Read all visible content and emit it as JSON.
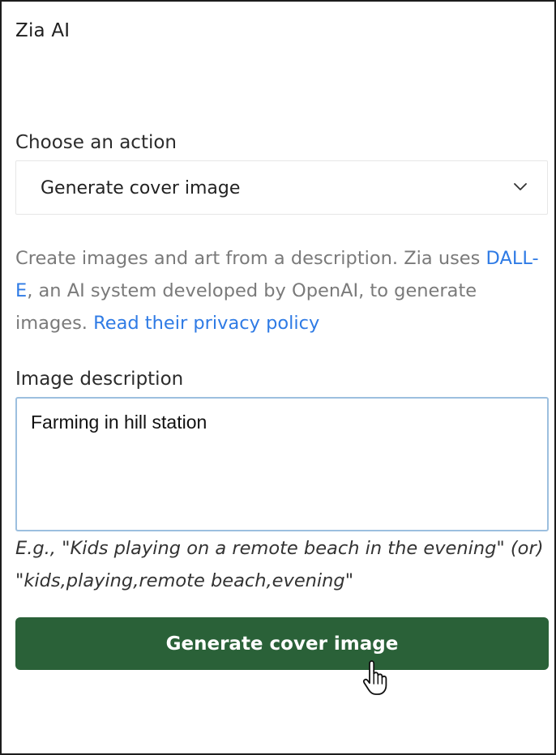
{
  "panel": {
    "title": "Zia AI"
  },
  "action": {
    "label": "Choose an action",
    "selected": "Generate cover image"
  },
  "help": {
    "text_before": "Create images and art from a description. Zia uses ",
    "dalle_link": "DALL-E",
    "text_middle": ", an AI system developed by OpenAI, to generate images. ",
    "privacy_link": "Read their privacy policy"
  },
  "description": {
    "label": "Image description",
    "value": "Farming in hill station",
    "example": "E.g., \"Kids playing on a remote beach in the evening\" (or) \"kids,playing,remote beach,evening\""
  },
  "buttons": {
    "generate_label": "Generate cover image"
  },
  "colors": {
    "button_bg": "#2a6138",
    "link": "#2f7be5",
    "textarea_focus_border": "#9cbfdf"
  },
  "icons": {
    "dropdown": "chevron-down-icon",
    "pointer": "hand-pointer-cursor-icon"
  }
}
